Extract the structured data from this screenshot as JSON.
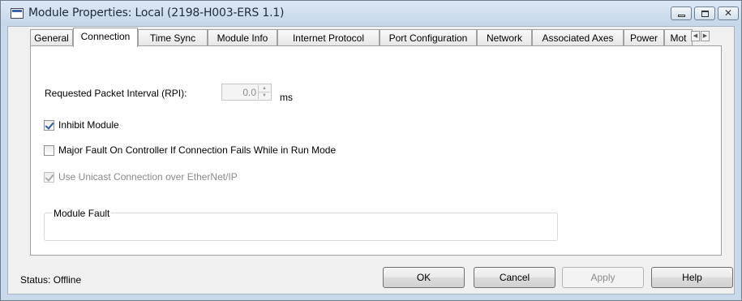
{
  "window": {
    "title": "Module Properties: Local (2198-H003-ERS 1.1)",
    "controls": {
      "close_glyph": "✕"
    }
  },
  "tabs": [
    {
      "label": "General"
    },
    {
      "label": "Connection",
      "active": true
    },
    {
      "label": "Time Sync"
    },
    {
      "label": "Module Info"
    },
    {
      "label": "Internet Protocol"
    },
    {
      "label": "Port Configuration"
    },
    {
      "label": "Network"
    },
    {
      "label": "Associated Axes"
    },
    {
      "label": "Power"
    },
    {
      "label": "Mot"
    }
  ],
  "tab_scroll": {
    "left": "◀",
    "right": "▶"
  },
  "connection": {
    "rpi_label": "Requested Packet Interval (RPI):",
    "rpi_value": "0.0",
    "rpi_unit": "ms",
    "spin_up": "▲",
    "spin_down": "▼",
    "inhibit_label": "Inhibit Module",
    "inhibit_checked": true,
    "major_fault_label": "Major Fault On Controller If Connection Fails While in Run Mode",
    "major_fault_checked": false,
    "unicast_label": "Use Unicast Connection over EtherNet/IP",
    "unicast_checked": true,
    "unicast_enabled": false,
    "module_fault_title": "Module Fault"
  },
  "footer": {
    "status": "Status:  Offline",
    "ok": "OK",
    "cancel": "Cancel",
    "apply": "Apply",
    "help": "Help"
  }
}
